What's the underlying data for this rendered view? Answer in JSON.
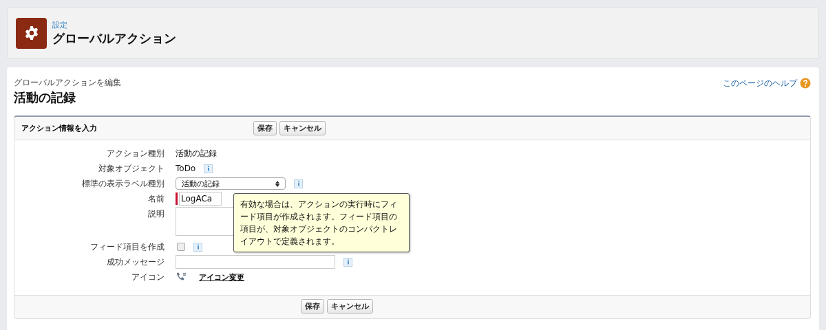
{
  "header": {
    "breadcrumb": "設定",
    "title": "グローバルアクション"
  },
  "page": {
    "subtitle": "グローバルアクションを編集",
    "title": "活動の記録",
    "help_link": "このページのヘルプ"
  },
  "section": {
    "title": "アクション情報を入力",
    "buttons": [
      "保存",
      "キャンセル"
    ],
    "bottom_buttons": [
      "保存",
      "キャンセル"
    ]
  },
  "fields": [
    {
      "kind": "text",
      "label": "アクション種別",
      "value": "活動の記録",
      "info": false
    },
    {
      "kind": "text",
      "label": "対象オブジェクト",
      "value": "ToDo",
      "info": true
    },
    {
      "kind": "select",
      "label": "標準の表示ラベル種別",
      "value": "活動の記録",
      "info": true
    },
    {
      "kind": "input",
      "label": "名前",
      "value": "LogACa",
      "required": true,
      "info": false
    },
    {
      "kind": "textarea",
      "label": "説明",
      "info": false
    },
    {
      "kind": "checkbox",
      "label": "フィード項目を作成",
      "checked": false,
      "info": true
    },
    {
      "kind": "input",
      "label": "成功メッセージ",
      "required": false,
      "info": true
    },
    {
      "kind": "icon",
      "label": "アイコン",
      "link": "アイコン変更"
    }
  ],
  "tooltip": "有効な場合は、アクションの実行時にフィード項目が作成されます。フィード項目の項目が、対象オブジェクトのコンパクトレイアウトで定義されます。"
}
